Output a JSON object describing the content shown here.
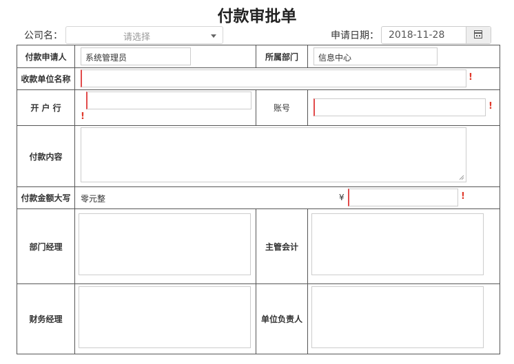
{
  "title": "付款审批单",
  "header": {
    "company_label": "公司名：",
    "company_placeholder": "请选择",
    "date_label": "申请日期：",
    "date_value": "2018-11-28"
  },
  "form": {
    "applicant_label": "付款申请人",
    "applicant_value": "系统管理员",
    "department_label": "所属部门",
    "department_value": "信息中心",
    "payee_label": "收款单位名称",
    "bank_label": "开 户 行",
    "account_label": "账号",
    "content_label": "付款内容",
    "amount_upper_label": "付款金额大写",
    "amount_upper_value": "零元整",
    "currency_symbol": "¥",
    "dept_manager_label": "部门经理",
    "chief_accountant_label": "主管会计",
    "finance_manager_label": "财务经理",
    "unit_head_label": "单位负责人",
    "required_mark": "!"
  },
  "colors": {
    "required": "#e0392b",
    "border": "#555555"
  },
  "icons": {
    "date_button": "calendar-icon",
    "select": "chevron-down-icon"
  }
}
